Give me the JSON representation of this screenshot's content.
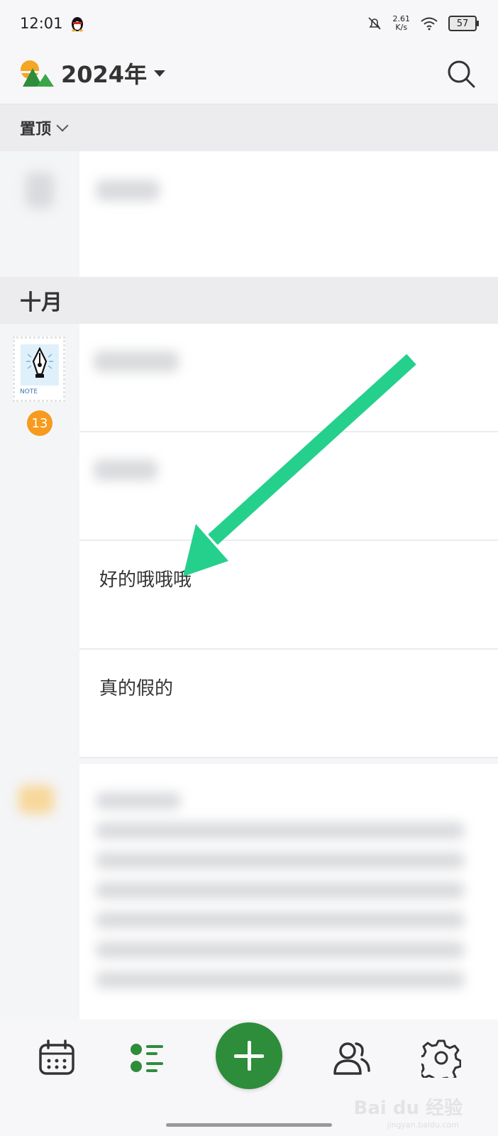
{
  "status_bar": {
    "time": "12:01",
    "speed_value": "2.61",
    "speed_unit": "K/s",
    "battery": "57"
  },
  "header": {
    "year": "2024年"
  },
  "pinned_section": {
    "label": "置顶"
  },
  "month_section": {
    "label": "十月",
    "stamp_text": "NOTE",
    "count": "13"
  },
  "notes": [
    {
      "text": ""
    },
    {
      "text": ""
    },
    {
      "text": "好的哦哦哦"
    },
    {
      "text": "真的假的"
    }
  ],
  "watermark": {
    "brand": "Bai du 经验",
    "sub": "jingyan.baidu.com"
  },
  "colors": {
    "accent": "#2e8d3a",
    "badge": "#f79a1e",
    "arrow": "#25d08c"
  }
}
